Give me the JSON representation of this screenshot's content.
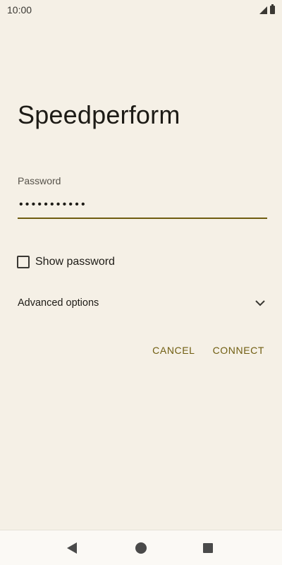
{
  "status_bar": {
    "time": "10:00",
    "icons": [
      "signal-icon",
      "battery-icon"
    ]
  },
  "dialog": {
    "title": "Speedperform",
    "password_label": "Password",
    "password_value": "•••••••••••",
    "show_password_label": "Show password",
    "show_password_checked": false,
    "advanced_options_label": "Advanced options",
    "cancel_label": "CANCEL",
    "connect_label": "CONNECT"
  },
  "nav_bar": {
    "buttons": [
      "back-icon",
      "home-icon",
      "recent-apps-icon"
    ]
  },
  "colors": {
    "background": "#f5f0e6",
    "accent": "#6f5d10",
    "text": "#1d1b16"
  }
}
